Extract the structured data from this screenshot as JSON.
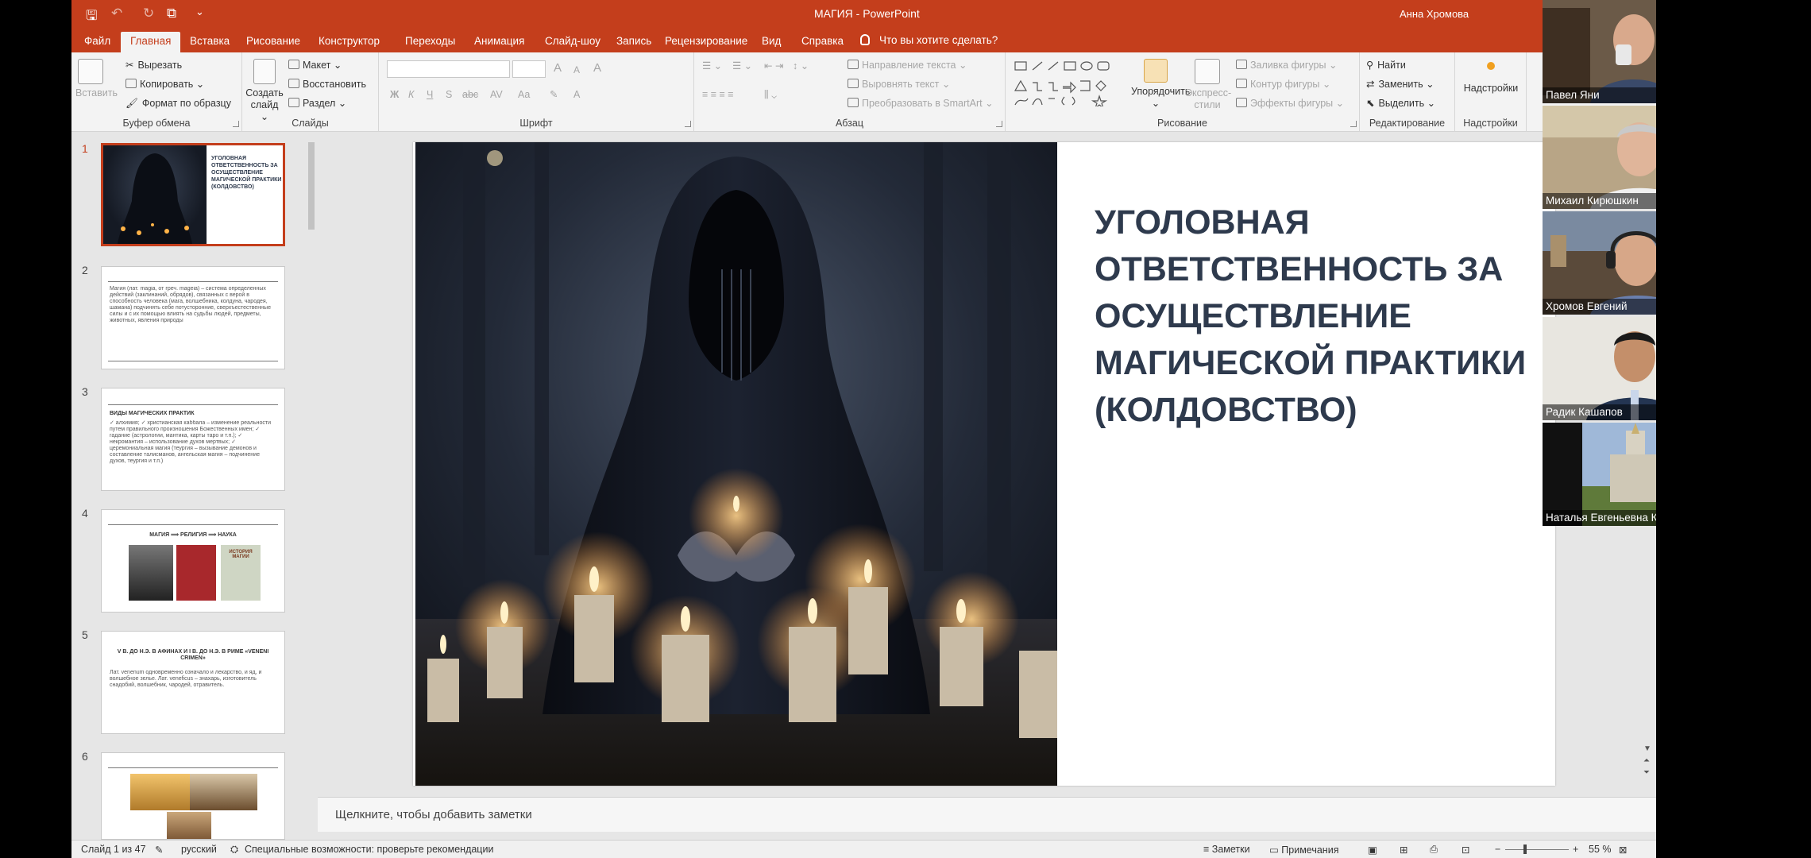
{
  "window": {
    "title": "МАГИЯ  -  PowerPoint",
    "user": "Анна Хромова"
  },
  "quick_access": [
    {
      "icon": "save-icon",
      "glyph": "🖫"
    },
    {
      "icon": "undo-icon",
      "glyph": "↶"
    },
    {
      "icon": "redo-icon",
      "glyph": "↻"
    },
    {
      "icon": "start-slideshow-icon",
      "glyph": "⧉"
    },
    {
      "icon": "customize-icon",
      "glyph": "⌄"
    }
  ],
  "tabs": [
    "Файл",
    "Главная",
    "Вставка",
    "Рисование",
    "Конструктор",
    "Переходы",
    "Анимация",
    "Слайд-шоу",
    "Запись",
    "Рецензирование",
    "Вид",
    "Справка"
  ],
  "active_tab": "Главная",
  "tell_me": "Что вы хотите сделать?",
  "ribbon": {
    "clipboard": {
      "label": "Буфер обмена",
      "paste": "Вставить",
      "cut": "Вырезать",
      "copy": "Копировать",
      "format_painter": "Формат по образцу"
    },
    "slides": {
      "label": "Слайды",
      "new_slide": "Создать слайд",
      "layout": "Макет",
      "reset": "Восстановить",
      "section": "Раздел"
    },
    "font": {
      "label": "Шрифт",
      "bold": "Ж",
      "italic": "К",
      "underline": "Ч",
      "strike": "S",
      "shadow": "abc",
      "grow": "A",
      "shrink": "A",
      "clear": "A"
    },
    "paragraph": {
      "label": "Абзац",
      "text_direction": "Направление текста",
      "align_text": "Выровнять текст",
      "smartart": "Преобразовать в SmartArt"
    },
    "drawing": {
      "label": "Рисование",
      "arrange": "Упорядочить",
      "quick_styles": "Экспресс-стили",
      "shape_fill": "Заливка фигуры",
      "shape_outline": "Контур фигуры",
      "shape_effects": "Эффекты фигуры"
    },
    "editing": {
      "label": "Редактирование",
      "find": "Найти",
      "replace": "Заменить",
      "select": "Выделить"
    },
    "addins": {
      "label": "Надстройки",
      "button": "Надстройки"
    }
  },
  "thumbnails": [
    {
      "num": "1",
      "text": "УГОЛОВНАЯ ОТВЕТСТВЕННОСТЬ ЗА ОСУЩЕСТВЛЕНИЕ МАГИЧЕСКОЙ ПРАКТИКИ (КОЛДОВСТВО)"
    },
    {
      "num": "2",
      "text": "Магия (лат. magia, от греч. mageia) – система определенных действий (заклинаний, обрядов), связанных с верой в способность человека (мага, волшебника, колдуна, чародея, шамана) подчинять себе потусторонние, сверхъестественные силы и с их помощью влиять на судьбы людей, предметы, животных, явления природы"
    },
    {
      "num": "3",
      "heading": "ВИДЫ МАГИЧЕСКИХ ПРАКТИК",
      "text": "✓ алхимия; ✓ христианская каббала – изменение реальности путем правильного произношения Божественных имен; ✓ гадание (астрологии, мантика, карты таро и т.п.); ✓ некромантия – использование духов мертвых; ✓ церемониальная магия (теургия – вызывание демонов и составление талисманов, ангельская магия – подчинение духов, теургия и т.п.)"
    },
    {
      "num": "4",
      "heading": "МАГИЯ ⟹ РЕЛИГИЯ ⟹ НАУКА",
      "book": "ИСТОРИЯ МАГИИ"
    },
    {
      "num": "5",
      "heading": "V В. ДО Н.Э. В АФИНАХ И I В. ДО Н.Э. В РИМЕ «VENENI CRIMEN»",
      "text": "Лат. venenum одновременно означало и лекарство, и яд, и волшебное зелье. Лат. veneficus – знахарь, изготовитель снадобий, волшебник, чародей, отравитель."
    },
    {
      "num": "6"
    }
  ],
  "slide": {
    "title": "УГОЛОВНАЯ ОТВЕТСТВЕННОСТЬ ЗА ОСУЩЕСТВЛЕНИЕ МАГИЧЕСКОЙ ПРАКТИКИ (КОЛДОВСТВО)"
  },
  "notes_placeholder": "Щелкните, чтобы добавить заметки",
  "status": {
    "slide_counter": "Слайд 1 из 47",
    "language": "русский",
    "accessibility": "Специальные возможности: проверьте рекомендации",
    "notes": "Заметки",
    "comments": "Примечания",
    "zoom": "55 %"
  },
  "participants": [
    "Павел Яни",
    "Михаил Кирюшкин",
    "Хромов Евгений",
    "Радик Кашапов",
    "Наталья Евгеньевна Крылова"
  ],
  "colors": {
    "accent": "#c43e1c",
    "slide_title": "#2e3a4d"
  }
}
